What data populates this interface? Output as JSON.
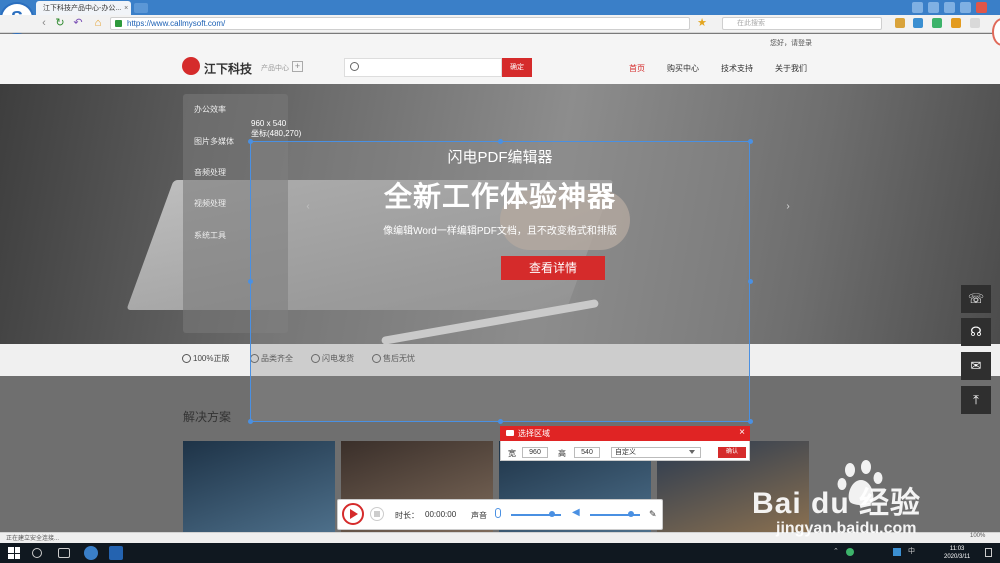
{
  "browser": {
    "tab_title": "江下科技产品中心-办公...",
    "url": "https://www.callmysoft.com/",
    "search_placeholder": "在此搜索"
  },
  "site": {
    "login_text": "您好，请登录",
    "logo_text": "江下科技",
    "logo_sub": "产品中心",
    "logo_plus": "+",
    "search_button": "确定",
    "menu": [
      "首页",
      "购买中心",
      "技术支持",
      "关于我们"
    ],
    "categories": [
      "办公效率",
      "图片多媒体",
      "音频处理",
      "视频处理",
      "系统工具"
    ],
    "services": [
      "100%正版",
      "品类齐全",
      "闪电发货",
      "售后无忧"
    ],
    "solutions_title": "解决方案"
  },
  "banner": {
    "title": "闪电PDF编辑器",
    "headline": "全新工作体验神器",
    "description": "像编辑Word一样编辑PDF文档，且不改变格式和排版",
    "cta": "查看详情",
    "arrow_left": "‹",
    "arrow_right": "›"
  },
  "capture": {
    "size_text": "960 x 540",
    "coord_text": "坐标(480,270)"
  },
  "region_dialog": {
    "title": "选择区域",
    "close": "×",
    "width_label": "宽",
    "width_value": "960",
    "height_label": "高",
    "height_value": "540",
    "preset": "自定义",
    "confirm": "确认"
  },
  "recorder": {
    "duration_label": "时长：",
    "duration_value": "00:00:00",
    "sound_label": "声音",
    "mic_level": 0.75,
    "speaker_level": 0.75
  },
  "status": {
    "text": "正在建立安全连接...",
    "zoom": "100%"
  },
  "taskbar": {
    "time": "11:03",
    "date": "2020/3/11",
    "ime": "中"
  },
  "watermark": {
    "brand": "Bai du 经验",
    "url": "jingyan.baidu.com"
  },
  "colors": {
    "accent_red": "#d52b2b",
    "selection_blue": "#4a90e2",
    "browser_blue": "#3a7fc8"
  }
}
